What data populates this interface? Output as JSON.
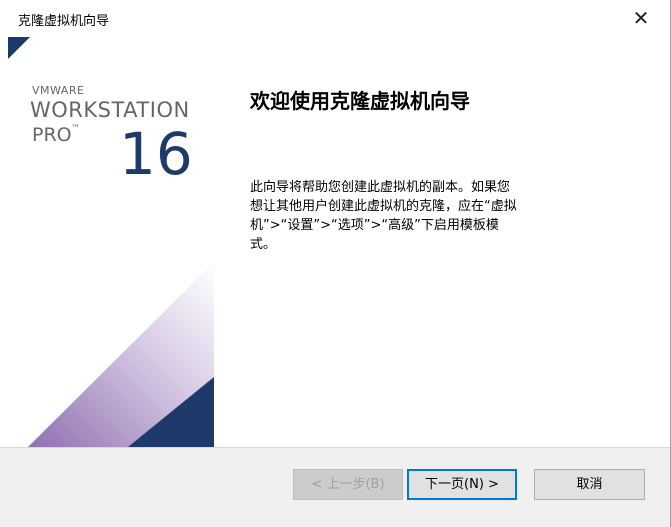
{
  "window": {
    "title": "克隆虚拟机向导",
    "close_symbol": "✕"
  },
  "banner": {
    "brand_small": "VMWARE",
    "product": "WORKSTATION",
    "edition": "PRO",
    "trademark": "™",
    "version": "16",
    "colors": {
      "navy": "#1d3a6b",
      "purple": "#8f6fb0",
      "text": "#666666"
    }
  },
  "main": {
    "heading": "欢迎使用克隆虚拟机向导",
    "description": "此向导将帮助您创建此虚拟机的副本。如果您想让其他用户创建此虚拟机的克隆，应在“虚拟机”>“设置”>“选项”>“高级”下启用模板模式。"
  },
  "footer": {
    "back_label": "< 上一步(B)",
    "next_label": "下一页(N) >",
    "cancel_label": "取消"
  }
}
